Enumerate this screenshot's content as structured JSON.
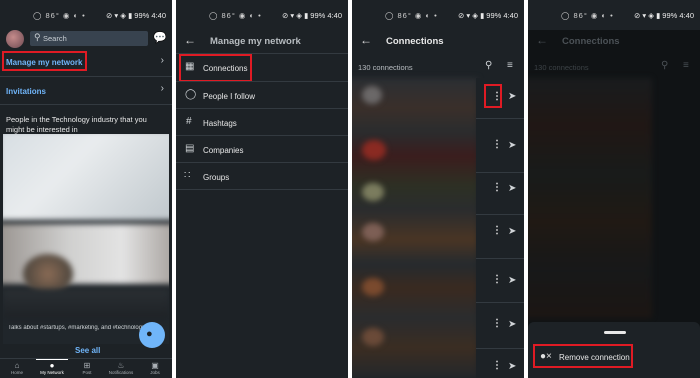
{
  "status_bar": {
    "left_icons": "◯ 86° ◉ ◐ •",
    "right": "⊘ ▾ ◈ ▮ 99% 4:40"
  },
  "panel1": {
    "search_placeholder": "Search",
    "manage_network_label": "Manage my network",
    "invitations_label": "Invitations",
    "people_heading": "People in the Technology industry that you might be interested in",
    "talks_about": "Talks about #startups, #marketing, and #technology",
    "see_all_label": "See all",
    "bottom_nav": [
      "Home",
      "My Network",
      "Post",
      "Notifications",
      "Jobs"
    ]
  },
  "panel2": {
    "title": "Manage my network",
    "items": [
      {
        "label": "Connections",
        "icon": "connections-icon"
      },
      {
        "label": "People I follow",
        "icon": "person-follow-icon"
      },
      {
        "label": "Hashtags",
        "icon": "hashtag-icon"
      },
      {
        "label": "Companies",
        "icon": "companies-icon"
      },
      {
        "label": "Groups",
        "icon": "groups-icon"
      }
    ]
  },
  "panel3": {
    "title": "Connections",
    "count_label": "130 connections"
  },
  "panel4": {
    "title": "Connections",
    "count_label": "130 connections",
    "remove_label": "Remove connection"
  },
  "colors": {
    "background": "#1d2226",
    "link_blue": "#70b5f9",
    "highlight_red": "#e01b24"
  }
}
